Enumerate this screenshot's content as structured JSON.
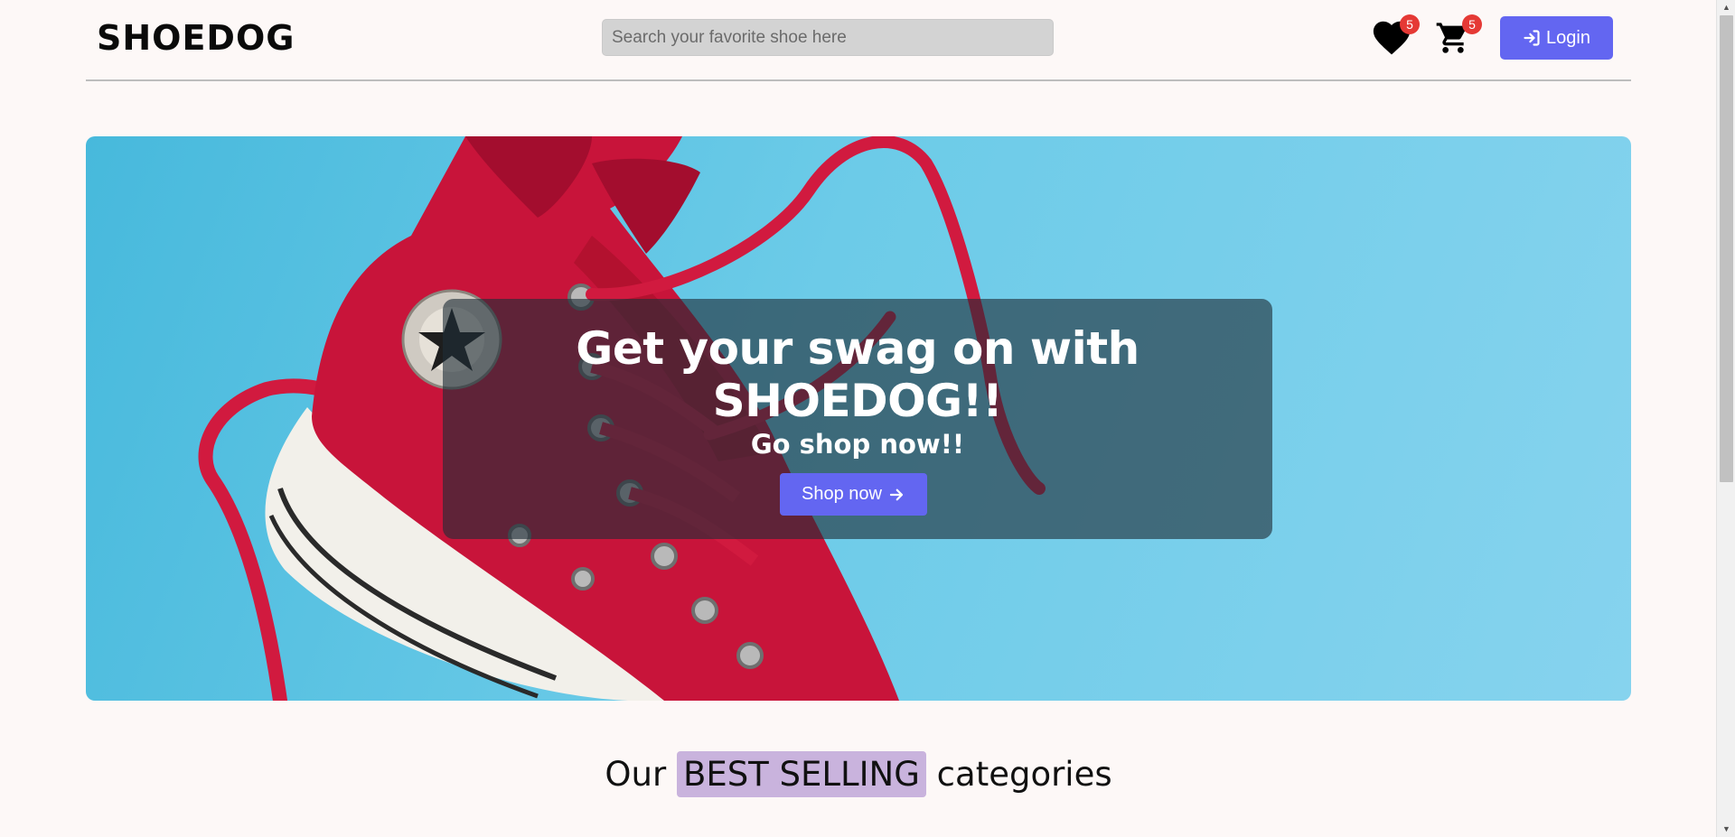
{
  "header": {
    "logo": "SHOEDOG",
    "search": {
      "placeholder": "Search your favorite shoe here",
      "value": ""
    },
    "wishlist": {
      "icon": "heart-icon",
      "count": "5"
    },
    "cart": {
      "icon": "cart-icon",
      "count": "5"
    },
    "login": {
      "icon": "login-icon",
      "label": "Login"
    }
  },
  "hero": {
    "image": "red-high-top-sneaker-photo",
    "title": "Get your swag on with SHOEDOG!!",
    "subtitle": "Go shop now!!",
    "button": {
      "label": "Shop now",
      "icon": "arrow-right-icon"
    }
  },
  "categories": {
    "title_prefix": "Our",
    "title_highlight": "BEST SELLING",
    "title_suffix": "categories"
  },
  "colors": {
    "accent": "#6366f1",
    "badge": "#e53935",
    "highlight": "#c9b3dd",
    "background": "#fdf8f7",
    "hero_sky": "#6ccbe8"
  }
}
